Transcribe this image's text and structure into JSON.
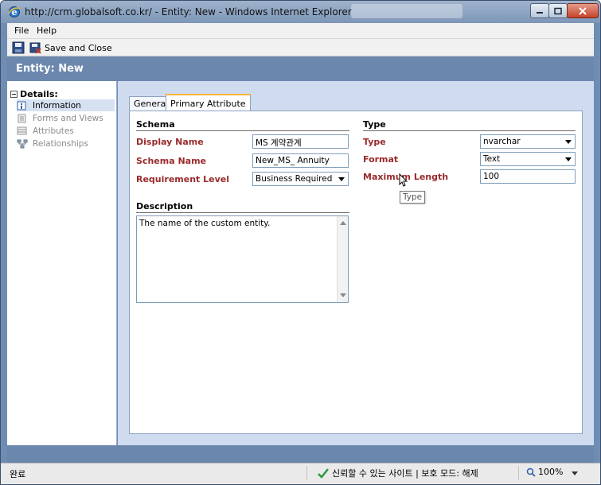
{
  "window": {
    "title": "http://crm.globalsoft.co.kr/ - Entity: New - Windows Internet Explorer"
  },
  "menu": {
    "file": "File",
    "help": "Help"
  },
  "toolbar": {
    "save_and_close": "Save and Close"
  },
  "header": {
    "title": "Entity: New"
  },
  "nav": {
    "section": "Details:",
    "items": [
      {
        "label": "Information",
        "active": true
      },
      {
        "label": "Forms and Views",
        "active": false
      },
      {
        "label": "Attributes",
        "active": false
      },
      {
        "label": "Relationships",
        "active": false
      }
    ]
  },
  "tabs": {
    "general": "General",
    "primary": "Primary Attribute"
  },
  "schema": {
    "title": "Schema",
    "display_name_label": "Display Name",
    "display_name_value": "MS 계약관계",
    "schema_name_label": "Schema Name",
    "schema_name_value": "New_MS_ Annuity",
    "requirement_label": "Requirement Level",
    "requirement_value": "Business Required"
  },
  "description": {
    "title": "Description",
    "value": "The name of the custom entity."
  },
  "type_section": {
    "title": "Type",
    "type_label": "Type",
    "type_value": "nvarchar",
    "format_label": "Format",
    "format_value": "Text",
    "maxlen_label": "Maximum Length",
    "maxlen_value": "100",
    "tooltip": "Type"
  },
  "status": {
    "left": "완료",
    "security": "신뢰할 수 있는 사이트 | 보호 모드: 해제",
    "zoom": "100%"
  },
  "colors": {
    "label_red": "#9b2a2a",
    "header_blue": "#6b87ad",
    "tab_accent": "#f5b83d"
  }
}
